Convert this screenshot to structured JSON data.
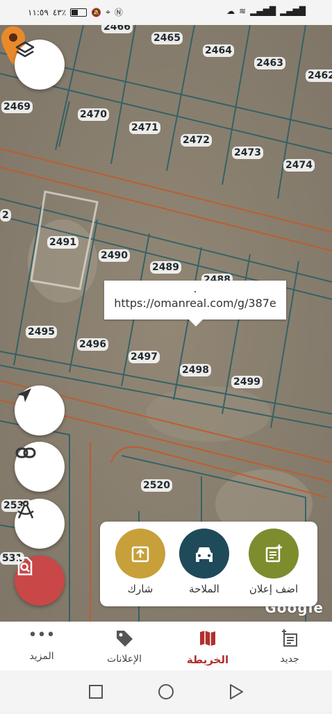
{
  "status_bar": {
    "time": "١١:٥٩",
    "battery": "٤٣٪"
  },
  "map": {
    "plots": [
      {
        "id": "2466",
        "label": "2466"
      },
      {
        "id": "2465",
        "label": "2465"
      },
      {
        "id": "2464",
        "label": "2464"
      },
      {
        "id": "2463",
        "label": "2463"
      },
      {
        "id": "2462",
        "label": "2462"
      },
      {
        "id": "2469",
        "label": "2469"
      },
      {
        "id": "2470",
        "label": "2470"
      },
      {
        "id": "2471",
        "label": "2471"
      },
      {
        "id": "2472",
        "label": "2472"
      },
      {
        "id": "2473",
        "label": "2473"
      },
      {
        "id": "2474",
        "label": "2474"
      },
      {
        "id": "2491",
        "label": "2491"
      },
      {
        "id": "2490",
        "label": "2490"
      },
      {
        "id": "2489",
        "label": "2489"
      },
      {
        "id": "2488",
        "label": "2488"
      },
      {
        "id": "2495",
        "label": "2495"
      },
      {
        "id": "2496",
        "label": "2496"
      },
      {
        "id": "2497",
        "label": "2497"
      },
      {
        "id": "2498",
        "label": "2498"
      },
      {
        "id": "2499",
        "label": "2499"
      },
      {
        "id": "2520",
        "label": "2520"
      },
      {
        "id": "2533",
        "label": "2533"
      },
      {
        "id": "2531",
        "label": "531"
      },
      {
        "id": "edge2",
        "label": "2"
      }
    ],
    "popup": {
      "dot": ".",
      "url": "https://omanreal.com/g/387e"
    },
    "attribution": "Google"
  },
  "map_controls": {
    "layers_icon": "layers-icon",
    "locate_icon": "navigation-arrow-icon",
    "link_icon": "link-icon",
    "measure_icon": "compass-icon",
    "search_icon": "document-search-icon"
  },
  "actions": {
    "share_label": "شارك",
    "navigation_label": "الملاحة",
    "add_ad_label": "اضف إعلان",
    "colors": {
      "share": "#c7a03a",
      "navigation": "#1f4a5a",
      "add_ad": "#7d8c2d"
    }
  },
  "bottom_nav": {
    "items": [
      {
        "label": "المزيد",
        "icon": "more-dots-icon"
      },
      {
        "label": "الإعلانات",
        "icon": "tag-icon"
      },
      {
        "label": "الخريطة",
        "icon": "map-icon",
        "active": true
      },
      {
        "label": "جديد",
        "icon": "new-list-icon"
      }
    ],
    "active_color": "#b0302e"
  }
}
